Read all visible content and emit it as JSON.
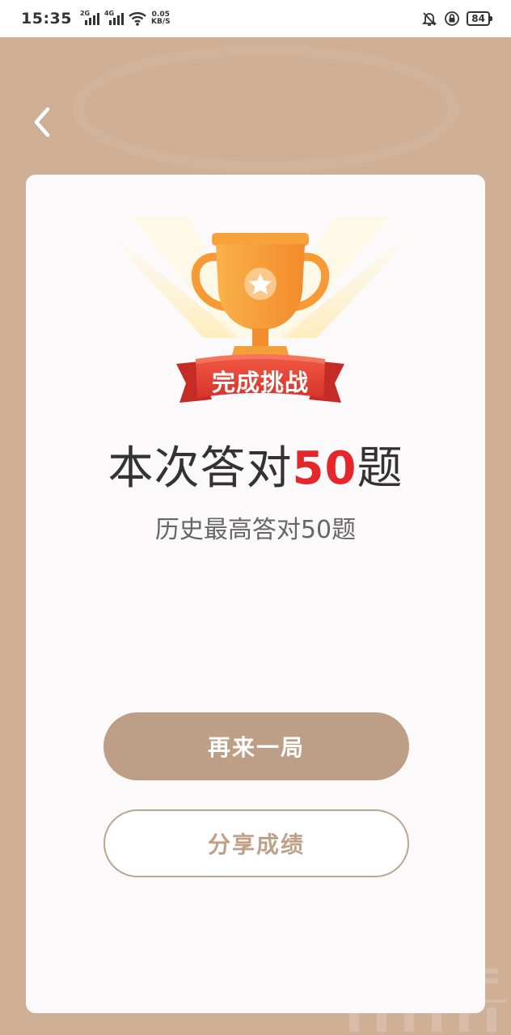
{
  "status_bar": {
    "time": "15:35",
    "signal_1_label": "2G",
    "signal_2_label": "4G",
    "net_speed_value": "0.05",
    "net_speed_unit": "KB/S",
    "battery_level": "84",
    "icons": [
      "signal-icon",
      "wifi-icon",
      "bell-muted-icon",
      "rotation-lock-icon",
      "battery-icon"
    ]
  },
  "nav": {
    "back_icon": "chevron-left-icon"
  },
  "result_card": {
    "badge_label": "完成挑战",
    "title_prefix": "本次答对",
    "title_number": "50",
    "title_suffix": "题",
    "subtitle": "历史最高答对50题"
  },
  "actions": {
    "retry_label": "再来一局",
    "share_label": "分享成绩"
  },
  "colors": {
    "background": "#CFAF96",
    "card": "#FCF9FB",
    "primary_button": "#BD9E87",
    "highlight_number": "#E5262A",
    "ribbon": "#E8463B",
    "trophy": "#F7A23C"
  }
}
